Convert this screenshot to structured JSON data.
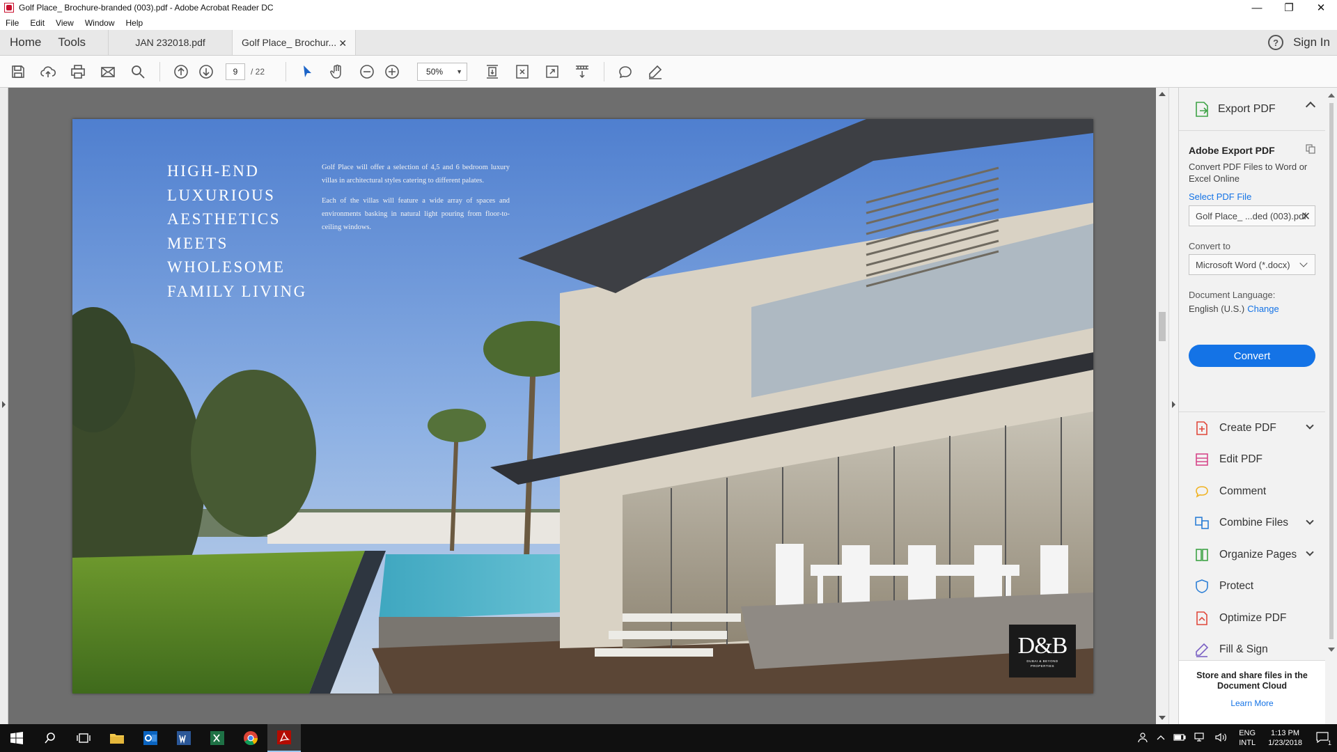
{
  "window": {
    "title": "Golf Place_ Brochure-branded (003).pdf - Adobe Acrobat Reader DC",
    "minimize": "—",
    "maximize": "❐",
    "close": "✕"
  },
  "menu": [
    "File",
    "Edit",
    "View",
    "Window",
    "Help"
  ],
  "tabs": {
    "home": "Home",
    "tools": "Tools",
    "docs": [
      {
        "label": "JAN 232018.pdf",
        "active": false
      },
      {
        "label": "Golf Place_ Brochur...",
        "active": true
      }
    ],
    "help_icon": "?",
    "sign_in": "Sign In"
  },
  "toolbar": {
    "page_current": "9",
    "page_total": "/ 22",
    "zoom": "50%"
  },
  "pdf_page": {
    "headline": [
      "HIGH-END",
      "LUXURIOUS",
      "AESTHETICS",
      "MEETS",
      "WHOLESOME",
      "FAMILY LIVING"
    ],
    "paragraph1": "Golf Place will offer a selection of 4,5 and 6 bedroom luxury villas in architectural styles catering to different palates.",
    "paragraph2": "Each of the villas will feature a wide array of spaces and environments basking in natural light pouring from floor-to-ceiling windows.",
    "logo_mark": "D&B",
    "logo_sub1": "DUBAI & BEYOND",
    "logo_sub2": "PROPERTIES"
  },
  "right_panel": {
    "export_header": "Export PDF",
    "title": "Adobe Export PDF",
    "description": "Convert PDF Files to Word or Excel Online",
    "select_link": "Select PDF File",
    "file_name": "Golf Place_ ...ded (003).pdf",
    "convert_to_label": "Convert to",
    "convert_to_value": "Microsoft Word (*.docx)",
    "doc_language_label": "Document Language:",
    "doc_language_value": "English (U.S.)",
    "change_link": "Change",
    "convert_button": "Convert",
    "tools": [
      {
        "label": "Create PDF",
        "expandable": true,
        "color": "#e0483b"
      },
      {
        "label": "Edit PDF",
        "expandable": false,
        "color": "#d6478a"
      },
      {
        "label": "Comment",
        "expandable": false,
        "color": "#f0b323"
      },
      {
        "label": "Combine Files",
        "expandable": true,
        "color": "#2d7fd6"
      },
      {
        "label": "Organize Pages",
        "expandable": true,
        "color": "#3fa347"
      },
      {
        "label": "Protect",
        "expandable": false,
        "color": "#2d7fd6"
      },
      {
        "label": "Optimize PDF",
        "expandable": false,
        "color": "#e0483b"
      },
      {
        "label": "Fill & Sign",
        "expandable": false,
        "color": "#7b61c4"
      }
    ],
    "cloud_text": "Store and share files in the Document Cloud",
    "learn_more": "Learn More"
  },
  "taskbar": {
    "lang_top": "ENG",
    "lang_bottom": "INTL",
    "time": "1:13 PM",
    "date": "1/23/2018",
    "notif_count": "1"
  },
  "colors": {
    "accent": "#1473e6",
    "viewport_bg": "#6e6e6e",
    "taskbar_bg": "#101010"
  }
}
